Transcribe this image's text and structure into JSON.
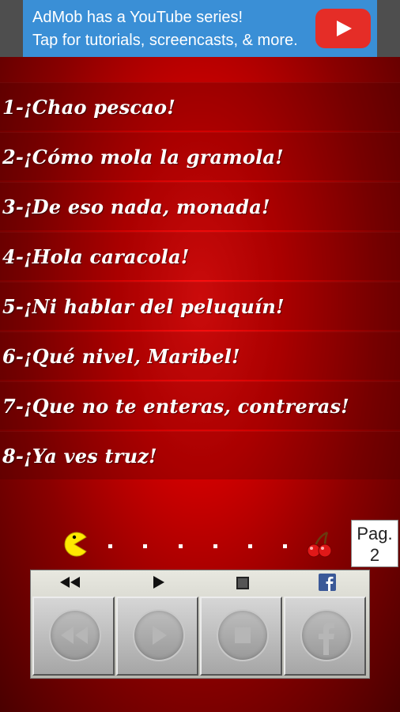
{
  "ad": {
    "line1": "AdMob has a YouTube series!",
    "line2": "Tap for tutorials, screencasts, & more.",
    "button_icon": "youtube-play-icon"
  },
  "phrases": [
    "1-¡Chao pescao!",
    "2-¡Cómo mola la gramola!",
    "3-¡De eso nada, monada!",
    "4-¡Hola caracola!",
    "5-¡Ni hablar del peluquín!",
    "6-¡Qué nivel, Maribel!",
    "7-¡Que no te enteras, contreras!",
    "8-¡Ya ves truz!"
  ],
  "page_indicator": {
    "label": "Pag.",
    "number": "2"
  },
  "controls": {
    "icons": [
      "rewind-icon",
      "play-icon",
      "stop-icon",
      "facebook-icon"
    ]
  },
  "colors": {
    "background_center": "#ff1010",
    "background_edge": "#4a0000",
    "ad_blue": "#3a8fd6",
    "youtube_red": "#e52d27",
    "pacman_yellow": "#ffe800"
  }
}
